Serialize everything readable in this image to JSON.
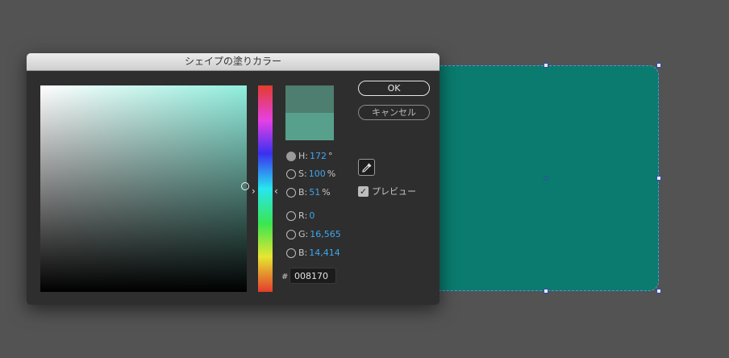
{
  "dialog": {
    "title": "シェイプの塗りカラー",
    "ok_label": "OK",
    "cancel_label": "キャンセル",
    "preview_label": "プレビュー",
    "preview_checked": true
  },
  "hsb": {
    "h": {
      "label": "H",
      "sep": ":",
      "value": "172",
      "unit": "°"
    },
    "s": {
      "label": "S",
      "sep": ":",
      "value": "100",
      "unit": "%"
    },
    "b": {
      "label": "B",
      "sep": ":",
      "value": "51",
      "unit": "%"
    }
  },
  "rgb": {
    "r": {
      "label": "R",
      "sep": ":",
      "value": "0"
    },
    "g": {
      "label": "G",
      "sep": ":",
      "value": "16,565"
    },
    "b": {
      "label": "B",
      "sep": ":",
      "value": "14,414"
    }
  },
  "hex": {
    "label": "#",
    "value": "008170"
  },
  "colors": {
    "new_swatch": "#4e7e6f",
    "old_swatch": "#57a08c",
    "shape_fill": "#0a7b6e",
    "value_text": "#3ea6ee"
  },
  "icons": {
    "eyedropper": "eyedropper-icon",
    "checkmark": "✓",
    "hue_left_arrow": "›",
    "hue_right_arrow": "‹"
  }
}
